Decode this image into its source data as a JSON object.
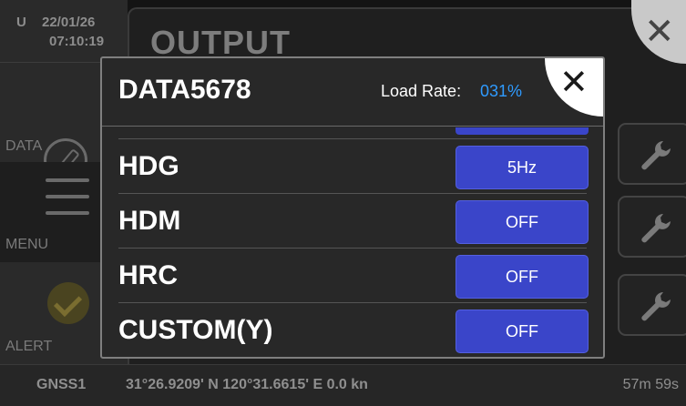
{
  "header": {
    "mode": "U",
    "date": "22/01/26",
    "time": "07:10:19",
    "screen_title": "OUTPUT"
  },
  "sidebar": {
    "items": [
      {
        "label": "DATA",
        "icon": "compass-icon"
      },
      {
        "label": "MENU",
        "icon": "menu-icon"
      },
      {
        "label": "ALERT",
        "icon": "check-icon"
      }
    ]
  },
  "status_bar": {
    "source": "GNSS1",
    "position": "31°26.9209' N  120°31.6615' E  0.0 kn",
    "elapsed": "57m 59s"
  },
  "dialog": {
    "title": "DATA5678",
    "load_rate_label": "Load Rate:",
    "load_rate_value": "031%",
    "rows": [
      {
        "name": "HDG",
        "value": "5Hz"
      },
      {
        "name": "HDM",
        "value": "OFF"
      },
      {
        "name": "HRC",
        "value": "OFF"
      },
      {
        "name": "CUSTOM(Y)",
        "value": "OFF"
      }
    ]
  },
  "colors": {
    "accent_blue": "#3a45c9",
    "rate_blue": "#2f9bff",
    "background": "#141414"
  }
}
